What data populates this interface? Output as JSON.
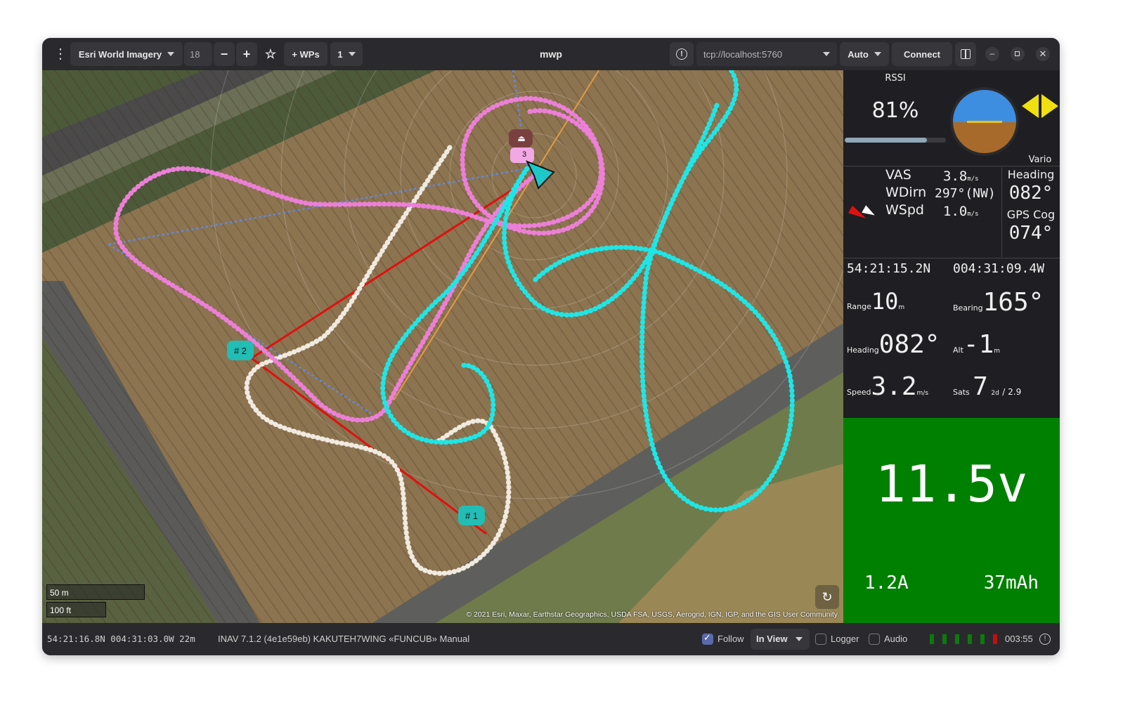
{
  "header": {
    "map_source": "Esri World Imagery",
    "zoom": "18",
    "zoom_out": "−",
    "zoom_in": "+",
    "wps_label": "+ WPs",
    "wp_count": "1",
    "title": "mwp",
    "device": "tcp://localhost:5760",
    "speed": "Auto",
    "connect": "Connect"
  },
  "map": {
    "attribution": "© 2021 Esri, Maxar, Earthstar Geographics, USDA FSA, USGS, Aerogrid, IGN, IGP, and the GIS User Community",
    "scale_metric": "50 m",
    "scale_imperial": "100 ft",
    "waypoints": [
      {
        "label": "# 1"
      },
      {
        "label": "# 2"
      },
      {
        "label": "3"
      }
    ]
  },
  "panel": {
    "rssi_label": "RSSI",
    "rssi_value": "81%",
    "rssi_level": 0.81,
    "vario_label": "Vario",
    "vas_label": "VAS",
    "vas_value": "3.8",
    "vas_unit": "m/s",
    "wdirn_label": "WDirn",
    "wdirn_value": "297°(NW)",
    "wspd_label": "WSpd",
    "wspd_value": "1.0",
    "wspd_unit": "m/s",
    "heading_label": "Heading",
    "heading_value": "082°",
    "gpscog_label": "GPS Cog",
    "gpscog_value": "074°",
    "lat": "54:21:15.2N",
    "lon": "004:31:09.4W",
    "range_label": "Range",
    "range_value": "10",
    "range_unit": "m",
    "bearing_label": "Bearing",
    "bearing_value": "165°",
    "heading2_label": "Heading",
    "heading2_value": "082°",
    "alt_label": "Alt",
    "alt_value": "-1",
    "alt_unit": "m",
    "speed_label": "Speed",
    "speed_value": "3.2",
    "speed_unit": "m/s",
    "sats_label": "Sats",
    "sats_value": "7",
    "sats_fix": "2d",
    "sats_hdop": "/ 2.9",
    "voltage": "11.5v",
    "current": "1.2A",
    "capacity": "37mAh",
    "volt_bg": "#008000"
  },
  "status": {
    "position": "54:21:16.8N 004:31:03.0W 22m",
    "fc_info": "INAV 7.1.2 (4e1e59eb) KAKUTEH7WING  «FUNCUB»  Manual",
    "follow_label": "Follow",
    "follow_checked": true,
    "view_mode": "In View",
    "logger_label": "Logger",
    "audio_label": "Audio",
    "elapsed": "003:55"
  }
}
